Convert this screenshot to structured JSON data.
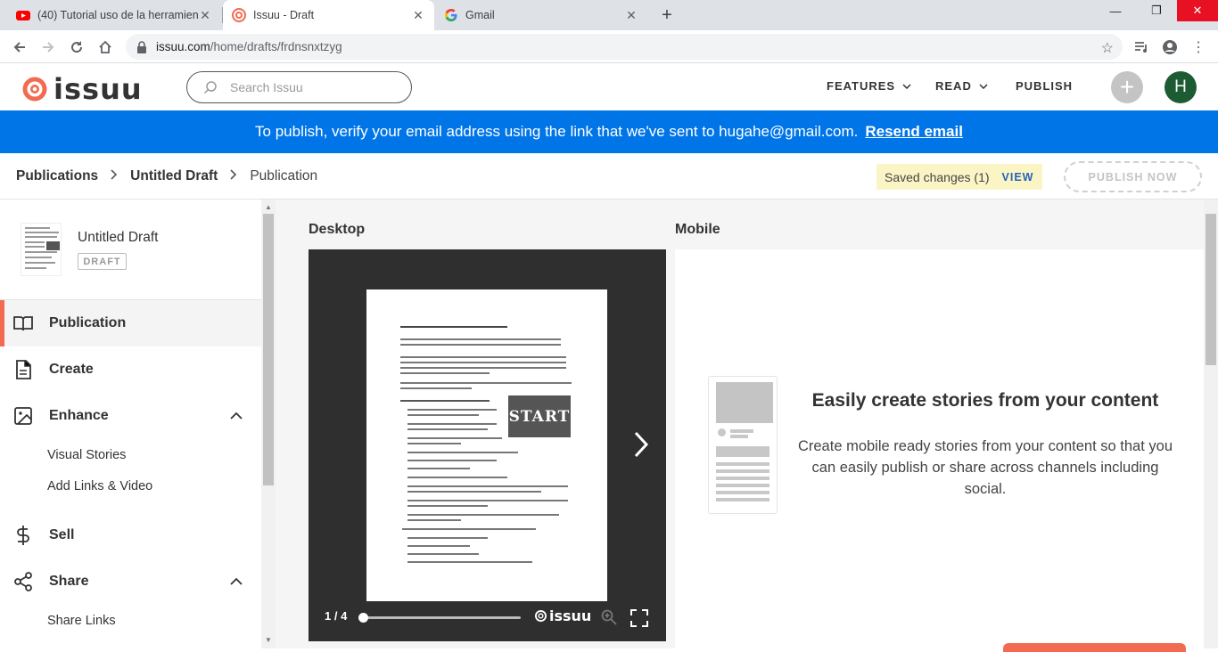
{
  "browser": {
    "tabs": [
      {
        "title": "(40) Tutorial uso de la herramient",
        "icon": "youtube-icon"
      },
      {
        "title": "Issuu - Draft",
        "icon": "issuu-icon"
      },
      {
        "title": "Gmail",
        "icon": "google-icon"
      }
    ],
    "url_host": "issuu.com",
    "url_path": "/home/drafts/frdnsnxtzyg"
  },
  "header": {
    "logo_text": "issuu",
    "search_placeholder": "Search Issuu",
    "nav": [
      "FEATURES",
      "READ",
      "PUBLISH"
    ],
    "avatar_letter": "H",
    "brand_color": "#f26b51"
  },
  "banner": {
    "text": "To publish, verify your email address using the link that we've sent to hugahe@gmail.com.",
    "link": "Resend email",
    "color": "#0075e8"
  },
  "breadcrumb": {
    "items": [
      "Publications",
      "Untitled Draft",
      "Publication"
    ],
    "saved_text": "Saved changes (1)",
    "view_label": "VIEW",
    "publish_now": "PUBLISH NOW"
  },
  "sidebar": {
    "doc_title": "Untitled Draft",
    "doc_badge": "DRAFT",
    "items": [
      {
        "label": "Publication",
        "icon": "book-icon"
      },
      {
        "label": "Create",
        "icon": "document-icon"
      },
      {
        "label": "Enhance",
        "icon": "image-icon"
      },
      {
        "label": "Sell",
        "icon": "dollar-icon"
      },
      {
        "label": "Share",
        "icon": "share-icon"
      }
    ],
    "enhance_sub": [
      "Visual Stories",
      "Add Links & Video"
    ],
    "share_sub": [
      "Share Links"
    ]
  },
  "main": {
    "desktop_label": "Desktop",
    "mobile_label": "Mobile",
    "viewer": {
      "page_indicator": "1 / 4",
      "logo": "issuu",
      "page_image_text": "START"
    },
    "mobile_heading": "Easily create stories from your content",
    "mobile_body": "Create mobile ready stories from your content so that you can easily publish or share across channels including social."
  }
}
